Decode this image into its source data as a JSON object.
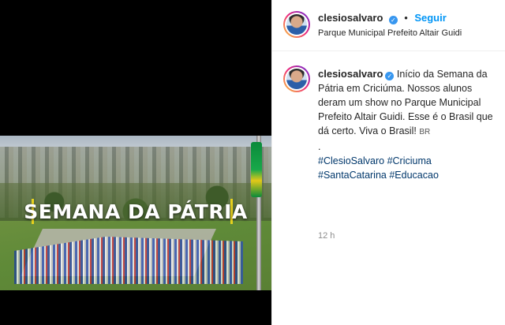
{
  "header": {
    "username": "clesiosalvaro",
    "separator": "•",
    "follow_label": "Seguir",
    "location": "Parque Municipal Prefeito Altair Guidi"
  },
  "media": {
    "overlay_title": "SEMANA DA PÁTRIA"
  },
  "caption": {
    "username": "clesiosalvaro",
    "text": "Início da Semana da Pátria em Criciúma. Nossos alunos deram um show no Parque Municipal Prefeito Altair Guidi. Esse é o Brasil que dá certo. Viva o Brasil!",
    "flag": "BR",
    "dot_line": ".",
    "hashtags": [
      "#ClesioSalvaro",
      "#Criciuma",
      "#SantaCatarina",
      "#Educacao"
    ],
    "time": "12 h"
  },
  "icons": {
    "verified": "verified-badge-icon",
    "avatar": "profile-avatar"
  },
  "colors": {
    "link": "#0095f6",
    "hashtag": "#00376b",
    "verified": "#3897f0",
    "meta": "#8e8e8e"
  }
}
